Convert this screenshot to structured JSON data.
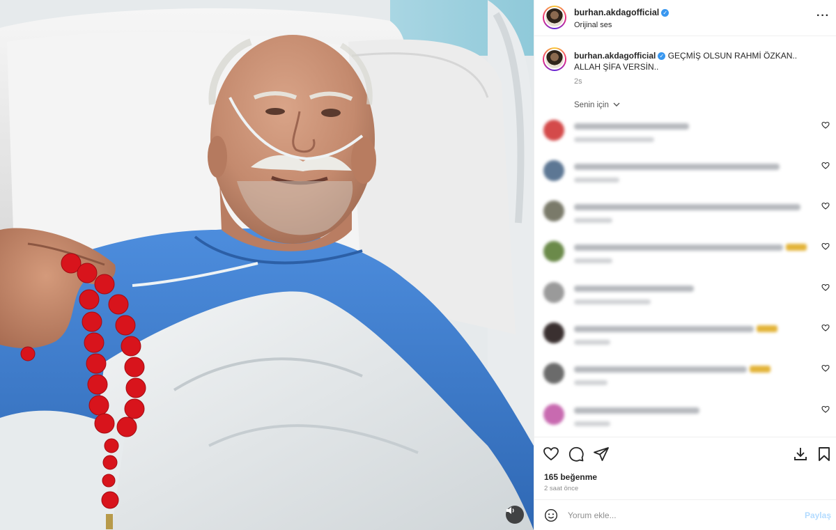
{
  "post": {
    "username": "burhan.akdagofficial",
    "audio": "Orijinal ses",
    "more_icon": "more-horizontal-icon"
  },
  "caption": {
    "username": "burhan.akdagofficial",
    "text": "GEÇMİŞ OLSUN RAHMİ ÖZKAN.. ALLAH ŞİFA VERSİN..",
    "time": "2s"
  },
  "comments_filter": {
    "label": "Senin için",
    "icon": "chevron-down-icon"
  },
  "comments": [
    {
      "avatar_color": "#d44a4a"
    },
    {
      "avatar_color": "#5d7794"
    },
    {
      "avatar_color": "#7a7a6a"
    },
    {
      "avatar_color": "#6b8a4a"
    },
    {
      "avatar_color": "#9a9a9a"
    },
    {
      "avatar_color": "#3a3030"
    },
    {
      "avatar_color": "#6b6b6b"
    },
    {
      "avatar_color": "#c86ab0"
    }
  ],
  "actions": {
    "likes": "165 beğenme",
    "time": "2 saat önce"
  },
  "comment_input": {
    "placeholder": "Yorum ekle...",
    "post_label": "Paylaş"
  },
  "colors": {
    "verified": "#3897f0",
    "post_button": "#b3dbff",
    "beads": "#d8141c",
    "gown": "#3f7fd0"
  }
}
